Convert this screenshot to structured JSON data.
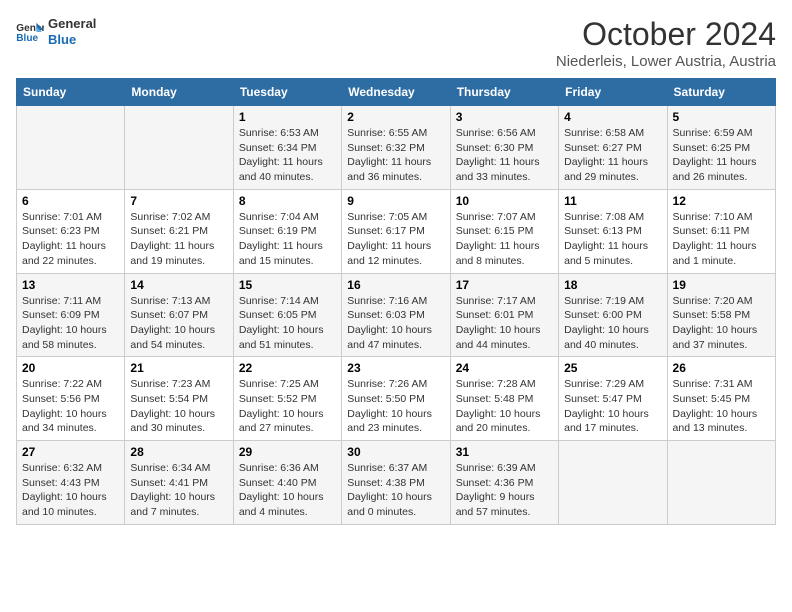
{
  "header": {
    "logo_line1": "General",
    "logo_line2": "Blue",
    "month": "October 2024",
    "location": "Niederleis, Lower Austria, Austria"
  },
  "days_of_week": [
    "Sunday",
    "Monday",
    "Tuesday",
    "Wednesday",
    "Thursday",
    "Friday",
    "Saturday"
  ],
  "weeks": [
    [
      {
        "day": "",
        "info": ""
      },
      {
        "day": "",
        "info": ""
      },
      {
        "day": "1",
        "info": "Sunrise: 6:53 AM\nSunset: 6:34 PM\nDaylight: 11 hours\nand 40 minutes."
      },
      {
        "day": "2",
        "info": "Sunrise: 6:55 AM\nSunset: 6:32 PM\nDaylight: 11 hours\nand 36 minutes."
      },
      {
        "day": "3",
        "info": "Sunrise: 6:56 AM\nSunset: 6:30 PM\nDaylight: 11 hours\nand 33 minutes."
      },
      {
        "day": "4",
        "info": "Sunrise: 6:58 AM\nSunset: 6:27 PM\nDaylight: 11 hours\nand 29 minutes."
      },
      {
        "day": "5",
        "info": "Sunrise: 6:59 AM\nSunset: 6:25 PM\nDaylight: 11 hours\nand 26 minutes."
      }
    ],
    [
      {
        "day": "6",
        "info": "Sunrise: 7:01 AM\nSunset: 6:23 PM\nDaylight: 11 hours\nand 22 minutes."
      },
      {
        "day": "7",
        "info": "Sunrise: 7:02 AM\nSunset: 6:21 PM\nDaylight: 11 hours\nand 19 minutes."
      },
      {
        "day": "8",
        "info": "Sunrise: 7:04 AM\nSunset: 6:19 PM\nDaylight: 11 hours\nand 15 minutes."
      },
      {
        "day": "9",
        "info": "Sunrise: 7:05 AM\nSunset: 6:17 PM\nDaylight: 11 hours\nand 12 minutes."
      },
      {
        "day": "10",
        "info": "Sunrise: 7:07 AM\nSunset: 6:15 PM\nDaylight: 11 hours\nand 8 minutes."
      },
      {
        "day": "11",
        "info": "Sunrise: 7:08 AM\nSunset: 6:13 PM\nDaylight: 11 hours\nand 5 minutes."
      },
      {
        "day": "12",
        "info": "Sunrise: 7:10 AM\nSunset: 6:11 PM\nDaylight: 11 hours\nand 1 minute."
      }
    ],
    [
      {
        "day": "13",
        "info": "Sunrise: 7:11 AM\nSunset: 6:09 PM\nDaylight: 10 hours\nand 58 minutes."
      },
      {
        "day": "14",
        "info": "Sunrise: 7:13 AM\nSunset: 6:07 PM\nDaylight: 10 hours\nand 54 minutes."
      },
      {
        "day": "15",
        "info": "Sunrise: 7:14 AM\nSunset: 6:05 PM\nDaylight: 10 hours\nand 51 minutes."
      },
      {
        "day": "16",
        "info": "Sunrise: 7:16 AM\nSunset: 6:03 PM\nDaylight: 10 hours\nand 47 minutes."
      },
      {
        "day": "17",
        "info": "Sunrise: 7:17 AM\nSunset: 6:01 PM\nDaylight: 10 hours\nand 44 minutes."
      },
      {
        "day": "18",
        "info": "Sunrise: 7:19 AM\nSunset: 6:00 PM\nDaylight: 10 hours\nand 40 minutes."
      },
      {
        "day": "19",
        "info": "Sunrise: 7:20 AM\nSunset: 5:58 PM\nDaylight: 10 hours\nand 37 minutes."
      }
    ],
    [
      {
        "day": "20",
        "info": "Sunrise: 7:22 AM\nSunset: 5:56 PM\nDaylight: 10 hours\nand 34 minutes."
      },
      {
        "day": "21",
        "info": "Sunrise: 7:23 AM\nSunset: 5:54 PM\nDaylight: 10 hours\nand 30 minutes."
      },
      {
        "day": "22",
        "info": "Sunrise: 7:25 AM\nSunset: 5:52 PM\nDaylight: 10 hours\nand 27 minutes."
      },
      {
        "day": "23",
        "info": "Sunrise: 7:26 AM\nSunset: 5:50 PM\nDaylight: 10 hours\nand 23 minutes."
      },
      {
        "day": "24",
        "info": "Sunrise: 7:28 AM\nSunset: 5:48 PM\nDaylight: 10 hours\nand 20 minutes."
      },
      {
        "day": "25",
        "info": "Sunrise: 7:29 AM\nSunset: 5:47 PM\nDaylight: 10 hours\nand 17 minutes."
      },
      {
        "day": "26",
        "info": "Sunrise: 7:31 AM\nSunset: 5:45 PM\nDaylight: 10 hours\nand 13 minutes."
      }
    ],
    [
      {
        "day": "27",
        "info": "Sunrise: 6:32 AM\nSunset: 4:43 PM\nDaylight: 10 hours\nand 10 minutes."
      },
      {
        "day": "28",
        "info": "Sunrise: 6:34 AM\nSunset: 4:41 PM\nDaylight: 10 hours\nand 7 minutes."
      },
      {
        "day": "29",
        "info": "Sunrise: 6:36 AM\nSunset: 4:40 PM\nDaylight: 10 hours\nand 4 minutes."
      },
      {
        "day": "30",
        "info": "Sunrise: 6:37 AM\nSunset: 4:38 PM\nDaylight: 10 hours\nand 0 minutes."
      },
      {
        "day": "31",
        "info": "Sunrise: 6:39 AM\nSunset: 4:36 PM\nDaylight: 9 hours\nand 57 minutes."
      },
      {
        "day": "",
        "info": ""
      },
      {
        "day": "",
        "info": ""
      }
    ]
  ]
}
